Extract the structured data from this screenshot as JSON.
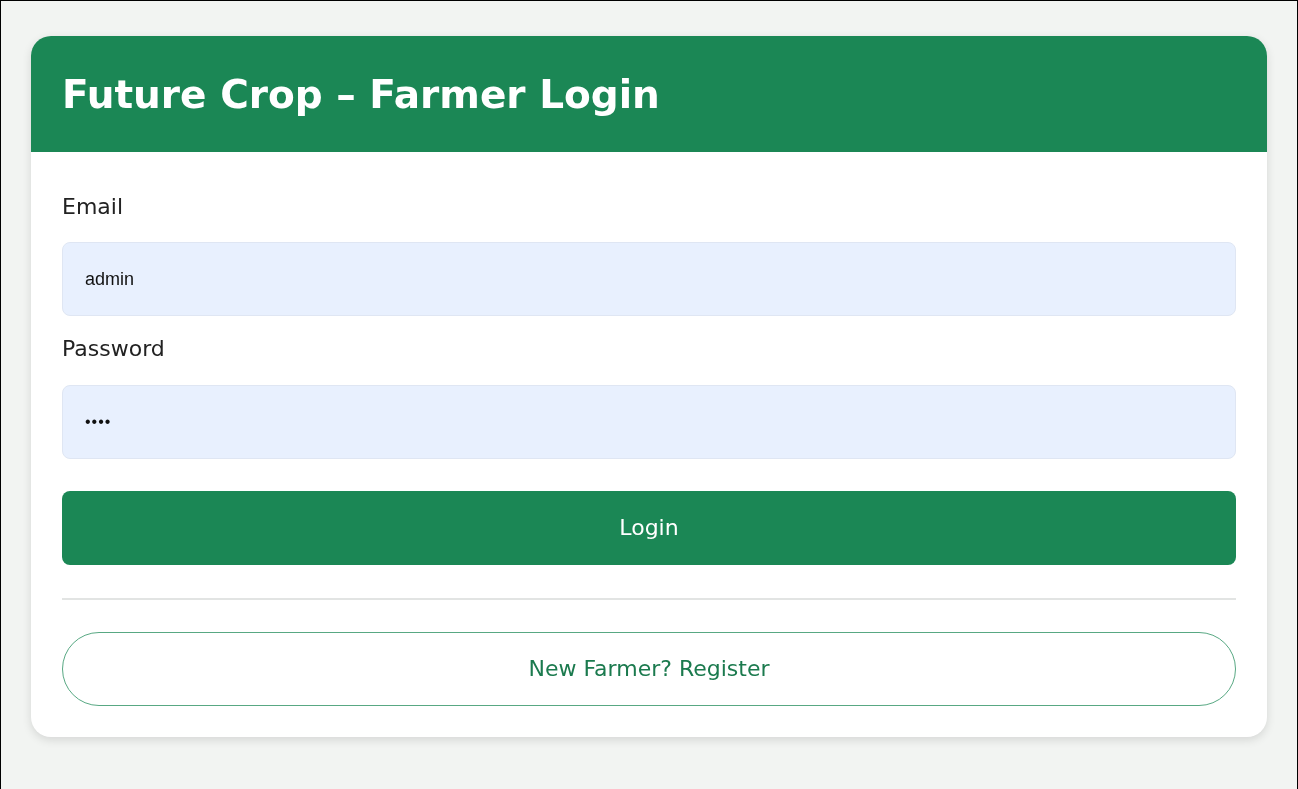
{
  "card": {
    "title": "Future Crop – Farmer Login"
  },
  "fields": [
    {
      "label": "Email",
      "value": "admin",
      "kind": "text"
    },
    {
      "label": "Password",
      "value": "••••",
      "kind": "password"
    }
  ],
  "login_button": "Login",
  "register_button": "New Farmer? Register"
}
